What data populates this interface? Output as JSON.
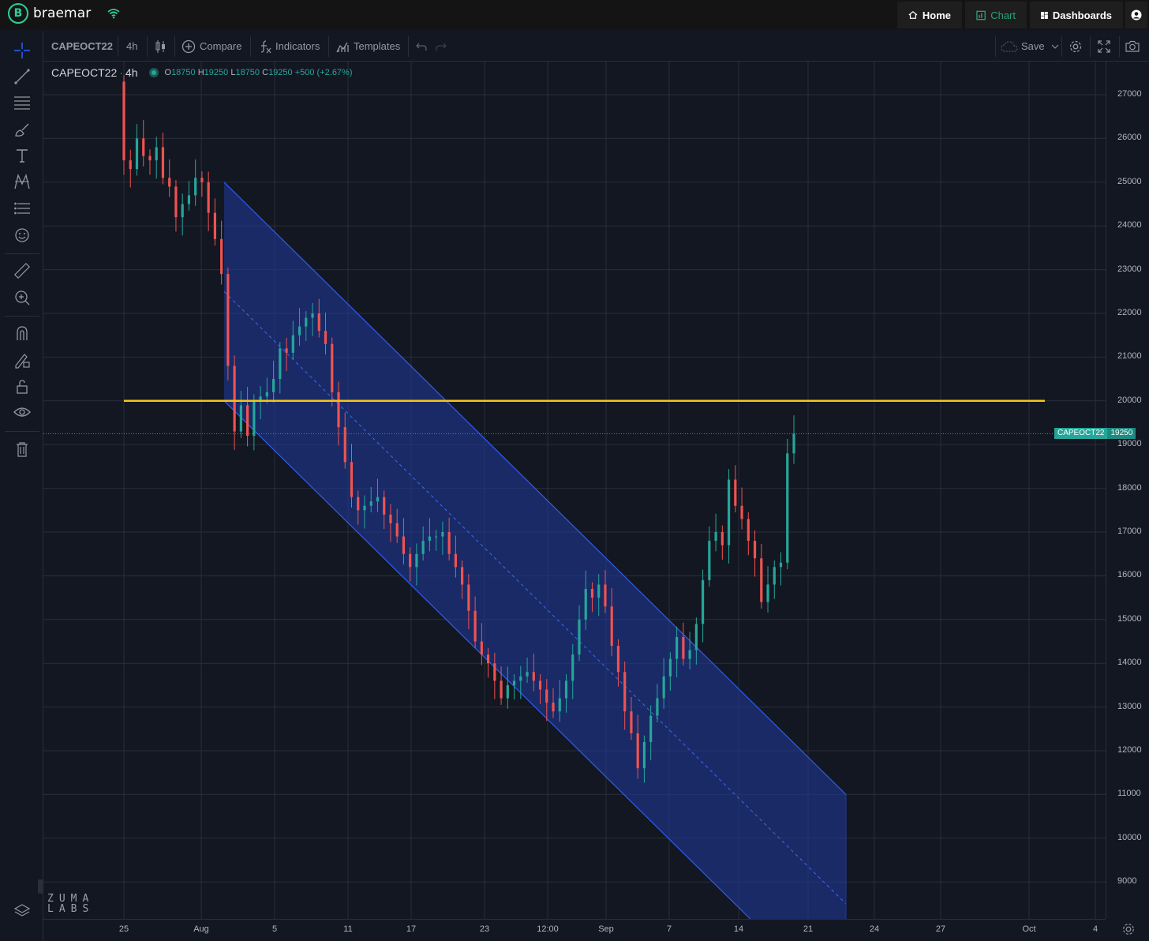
{
  "app": {
    "name": "braemar"
  },
  "nav": {
    "home": "Home",
    "chart": "Chart",
    "dashboards": "Dashboards"
  },
  "toolbar": {
    "symbol": "CAPEOCT22",
    "interval": "4h",
    "compare": "Compare",
    "indicators": "Indicators",
    "templates": "Templates",
    "save": "Save"
  },
  "legend": {
    "symbol": "CAPEOCT22",
    "interval": "4h",
    "o_label": "O",
    "o": "18750",
    "h_label": "H",
    "h": "19250",
    "l_label": "L",
    "l": "18750",
    "c_label": "C",
    "c": "19250",
    "change": "+500 (+2.67%)"
  },
  "price_tag": {
    "symbol": "CAPEOCT22",
    "price": "19250"
  },
  "watermark": {
    "line1": "ZUMA",
    "line2": "LABS"
  },
  "colors": {
    "up": "#26a69a",
    "down": "#ef5350",
    "channel": "#2b4cc8",
    "hline": "#f5c518",
    "accent": "#2fcf97"
  },
  "chart_data": {
    "type": "candlestick",
    "y_ticks": [
      27000,
      26000,
      25000,
      24000,
      23000,
      22000,
      21000,
      20000,
      19000,
      18000,
      17000,
      16000,
      15000,
      14000,
      13000,
      12000,
      11000,
      10000,
      9000
    ],
    "x_ticks": [
      "25",
      "Aug",
      "5",
      "11",
      "17",
      "23",
      "12:00",
      "Sep",
      "7",
      "14",
      "21",
      "24",
      "27",
      "Oct",
      "4"
    ],
    "last_price": 19250,
    "horizontal_line": 20000,
    "candle_closes": [
      25500,
      25300,
      26000,
      25600,
      25500,
      25800,
      25100,
      24900,
      24200,
      24500,
      24700,
      25100,
      25000,
      24300,
      23700,
      22900,
      20800,
      19300,
      19900,
      19200,
      20000,
      20100,
      20200,
      20500,
      21200,
      21100,
      21500,
      21700,
      21900,
      22000,
      21600,
      21300,
      20200,
      19400,
      18600,
      17800,
      17500,
      17600,
      17700,
      17800,
      17400,
      17200,
      16900,
      16500,
      16200,
      16500,
      16800,
      16900,
      16900,
      17000,
      16500,
      16200,
      15800,
      15200,
      14500,
      14200,
      14000,
      13600,
      13200,
      13500,
      13600,
      13700,
      13800,
      13600,
      13400,
      13100,
      12900,
      13200,
      13600,
      14200,
      15000,
      15700,
      15500,
      15800,
      15300,
      14400,
      13800,
      12900,
      12400,
      11600,
      12200,
      12800,
      13200,
      13700,
      14100,
      14600,
      14100,
      14300,
      14900,
      15900,
      16800,
      17000,
      16700,
      18200,
      17600,
      17300,
      16800,
      16400,
      15400,
      15800,
      16200,
      16300,
      18800,
      19250
    ],
    "channel": {
      "upper_start": {
        "x": "Aug 3",
        "y": 25000
      },
      "upper_end": {
        "x": "Sep 22",
        "y": 11000
      },
      "lower_start": {
        "x": "Aug 3",
        "y": 20000
      },
      "lower_end": {
        "x": "Sep 22",
        "y": 6000
      }
    }
  }
}
